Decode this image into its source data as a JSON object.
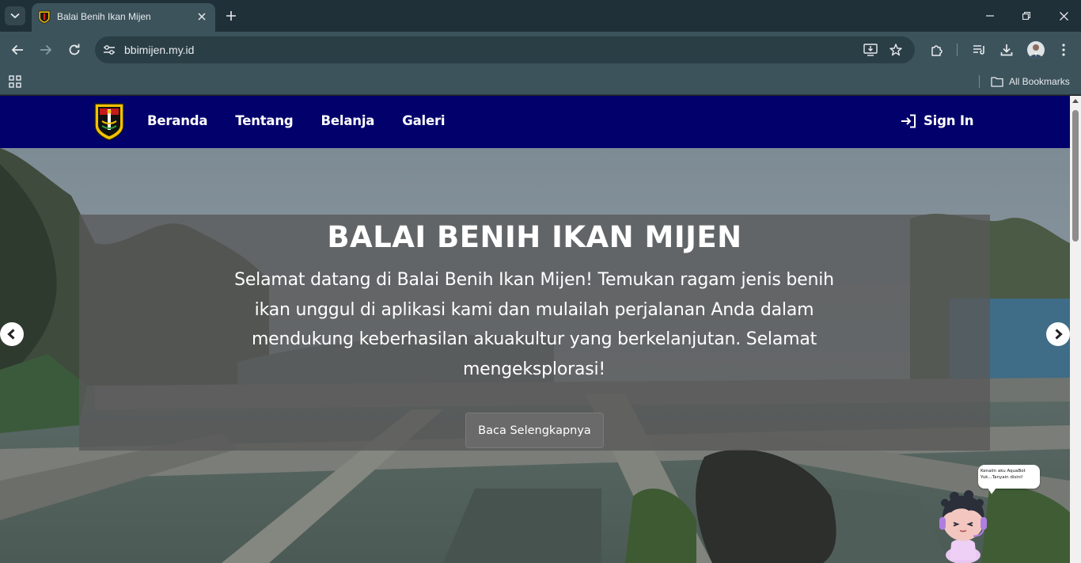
{
  "browser": {
    "tab_title": "Balai Benih Ikan Mijen",
    "url": "bbimijen.my.id",
    "bookmarks_label": "All Bookmarks",
    "icons": [
      "tab-search-icon",
      "close-icon",
      "plus-icon",
      "minimize-icon",
      "restore-icon",
      "back-icon",
      "forward-icon",
      "reload-icon",
      "site-settings-icon",
      "install-app-icon",
      "star-icon",
      "extensions-icon",
      "reading-list-icon",
      "download-icon",
      "profile-avatar",
      "more-menu-icon",
      "apps-grid-icon",
      "folder-icon"
    ]
  },
  "nav": {
    "links": [
      "Beranda",
      "Tentang",
      "Belanja",
      "Galeri"
    ],
    "signin_label": "Sign In",
    "background": "#02006b"
  },
  "hero": {
    "title": "BALAI BENIH IKAN MIJEN",
    "text": "Selamat datang di Balai Benih Ikan Mijen! Temukan ragam jenis benih ikan unggul di aplikasi kami dan mulailah perjalanan Anda dalam mendukung keberhasilan akuakultur yang berkelanjutan. Selamat mengeksplorasi!",
    "button_label": "Baca Selengkapnya"
  },
  "aquabot": {
    "line1": "Kenalin aku AquaBot",
    "line2": "Yuk...Tanyain disini!"
  }
}
